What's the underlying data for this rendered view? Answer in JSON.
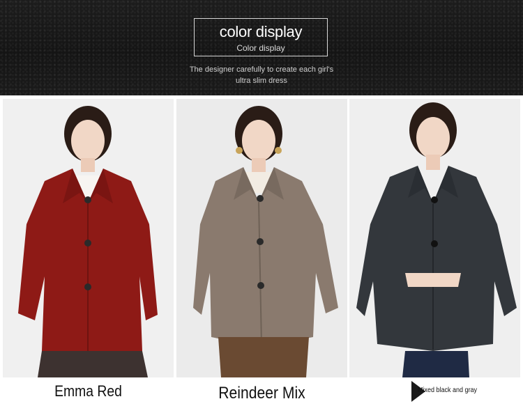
{
  "header": {
    "title": "color display",
    "subtitle": "Color display",
    "tagline_line1": "The designer  carefully to create each girl's",
    "tagline_line2": "ultra slim dress"
  },
  "products": [
    {
      "caption": "Emma Red",
      "coat_color": "#8e1a16",
      "icon": "model-photo"
    },
    {
      "caption": "Reindeer Mix",
      "coat_color": "#8a7a6e",
      "icon": "model-photo"
    },
    {
      "caption": "Mixed black and gray",
      "coat_color": "#33373c",
      "icon": "model-photo"
    }
  ]
}
